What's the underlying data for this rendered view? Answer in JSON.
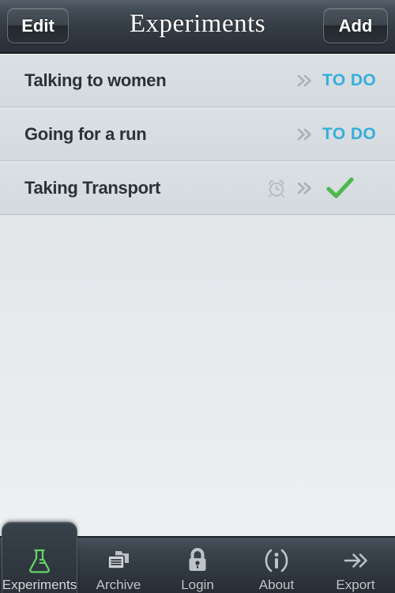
{
  "header": {
    "title": "Experiments",
    "edit_label": "Edit",
    "add_label": "Add"
  },
  "list": {
    "rows": [
      {
        "title": "Talking to women",
        "status_label": "TO DO",
        "status_type": "todo",
        "has_alarm": false
      },
      {
        "title": "Going for a run",
        "status_label": "TO DO",
        "status_type": "todo",
        "has_alarm": false
      },
      {
        "title": "Taking Transport",
        "status_label": "",
        "status_type": "done",
        "has_alarm": true
      }
    ]
  },
  "tabbar": {
    "items": [
      {
        "label": "Experiments",
        "icon": "flask-icon",
        "active": true
      },
      {
        "label": "Archive",
        "icon": "archive-icon",
        "active": false
      },
      {
        "label": "Login",
        "icon": "lock-icon",
        "active": false
      },
      {
        "label": "About",
        "icon": "info-icon",
        "active": false
      },
      {
        "label": "Export",
        "icon": "export-arrow-icon",
        "active": false
      }
    ]
  },
  "colors": {
    "accent_blue": "#36aedd",
    "accent_green": "#4cb84c",
    "navbar_dark": "#333b43",
    "row_background": "#d7dde1"
  }
}
